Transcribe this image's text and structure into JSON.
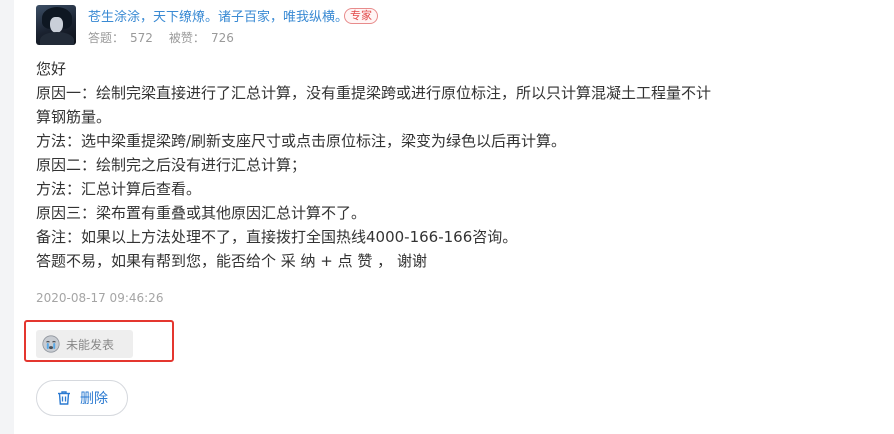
{
  "user": {
    "name": "苍生涂涂，天下缭燎。诸子百家，唯我纵横。",
    "badge": "专家",
    "answers_label": "答题：",
    "answers_count": "572",
    "likes_label": "被赞：",
    "likes_count": "726"
  },
  "answer": {
    "lines": [
      "您好",
      "原因一：绘制完梁直接进行了汇总计算，没有重提梁跨或进行原位标注，所以只计算混凝土工程量不计",
      "算钢筋量。",
      "方法：选中梁重提梁跨/刷新支座尺寸或点击原位标注，梁变为绿色以后再计算。",
      "原因二：绘制完之后没有进行汇总计算；",
      "方法：汇总计算后查看。",
      "原因三：梁布置有重叠或其他原因汇总计算不了。",
      "备注：如果以上方法处理不了，直接拨打全国热线4000-166-166咨询。",
      "答题不易，如果有帮到您，能否给个 采 纳 + 点 赞  ， 谢谢"
    ],
    "timestamp": "2020-08-17 09:46:26"
  },
  "status": {
    "label": "未能发表",
    "icon": "crying-face-icon"
  },
  "actions": {
    "delete_label": "删除",
    "delete_icon": "trash-icon"
  },
  "colors": {
    "link": "#3a8ad3",
    "badge": "#e24a4a",
    "highlight": "#e4362f",
    "action": "#2b7ad1"
  }
}
